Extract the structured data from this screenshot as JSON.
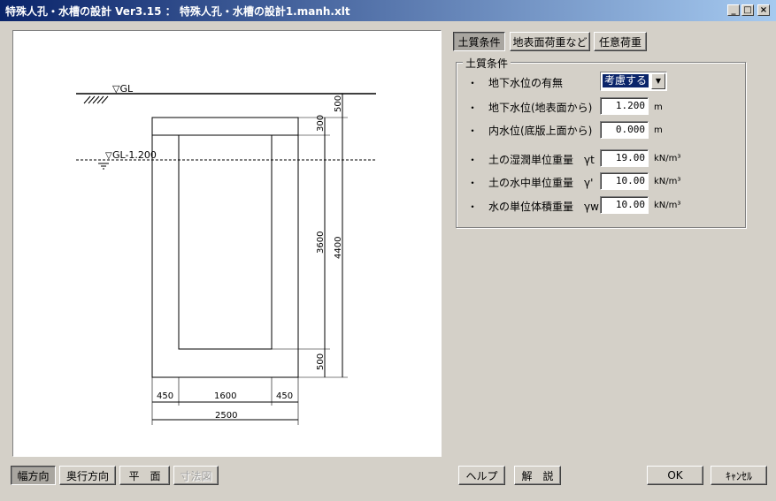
{
  "window": {
    "title": "特殊人孔・水槽の設計 Ver3.15 ： 特殊人孔・水槽の設計1.manh.xlt",
    "minimize": "_",
    "maximize": "□",
    "close": "×"
  },
  "drawing": {
    "gl_label": "▽GL",
    "water_label": "GL-1.200",
    "dim_top": "500",
    "dim_inner_top": "300",
    "dim_inner": "3600",
    "dim_total": "4400",
    "dim_bottom": "500",
    "dim_wall_left": "450",
    "dim_inner_width": "1600",
    "dim_wall_right": "450",
    "dim_total_width": "2500"
  },
  "tabs": [
    {
      "label": "土質条件"
    },
    {
      "label": "地表面荷重など"
    },
    {
      "label": "任意荷重"
    }
  ],
  "group": {
    "title": "土質条件",
    "rows": [
      {
        "label": "・　地下水位の有無"
      },
      {
        "label": "・　地下水位(地表面から)",
        "value": "1.200",
        "unit": "m"
      },
      {
        "label": "・　内水位(底版上面から)",
        "value": "0.000",
        "unit": "m"
      },
      {
        "label": "・　土の湿潤単位重量　γt",
        "value": "19.00",
        "unit": "kN/m³"
      },
      {
        "label": "・　土の水中単位重量　γ'",
        "value": "10.00",
        "unit": "kN/m³"
      },
      {
        "label": "・　水の単位体積重量　γw",
        "value": "10.00",
        "unit": "kN/m³"
      }
    ],
    "groundwater_select": "考慮する"
  },
  "view_buttons": [
    {
      "label": "幅方向"
    },
    {
      "label": "奥行方向"
    },
    {
      "label": "平　面"
    },
    {
      "label": "寸法図"
    }
  ],
  "bottom_buttons": {
    "help": "ヘルプ",
    "explain": "解　説",
    "ok": "OK",
    "cancel": "ｷｬﾝｾﾙ"
  }
}
